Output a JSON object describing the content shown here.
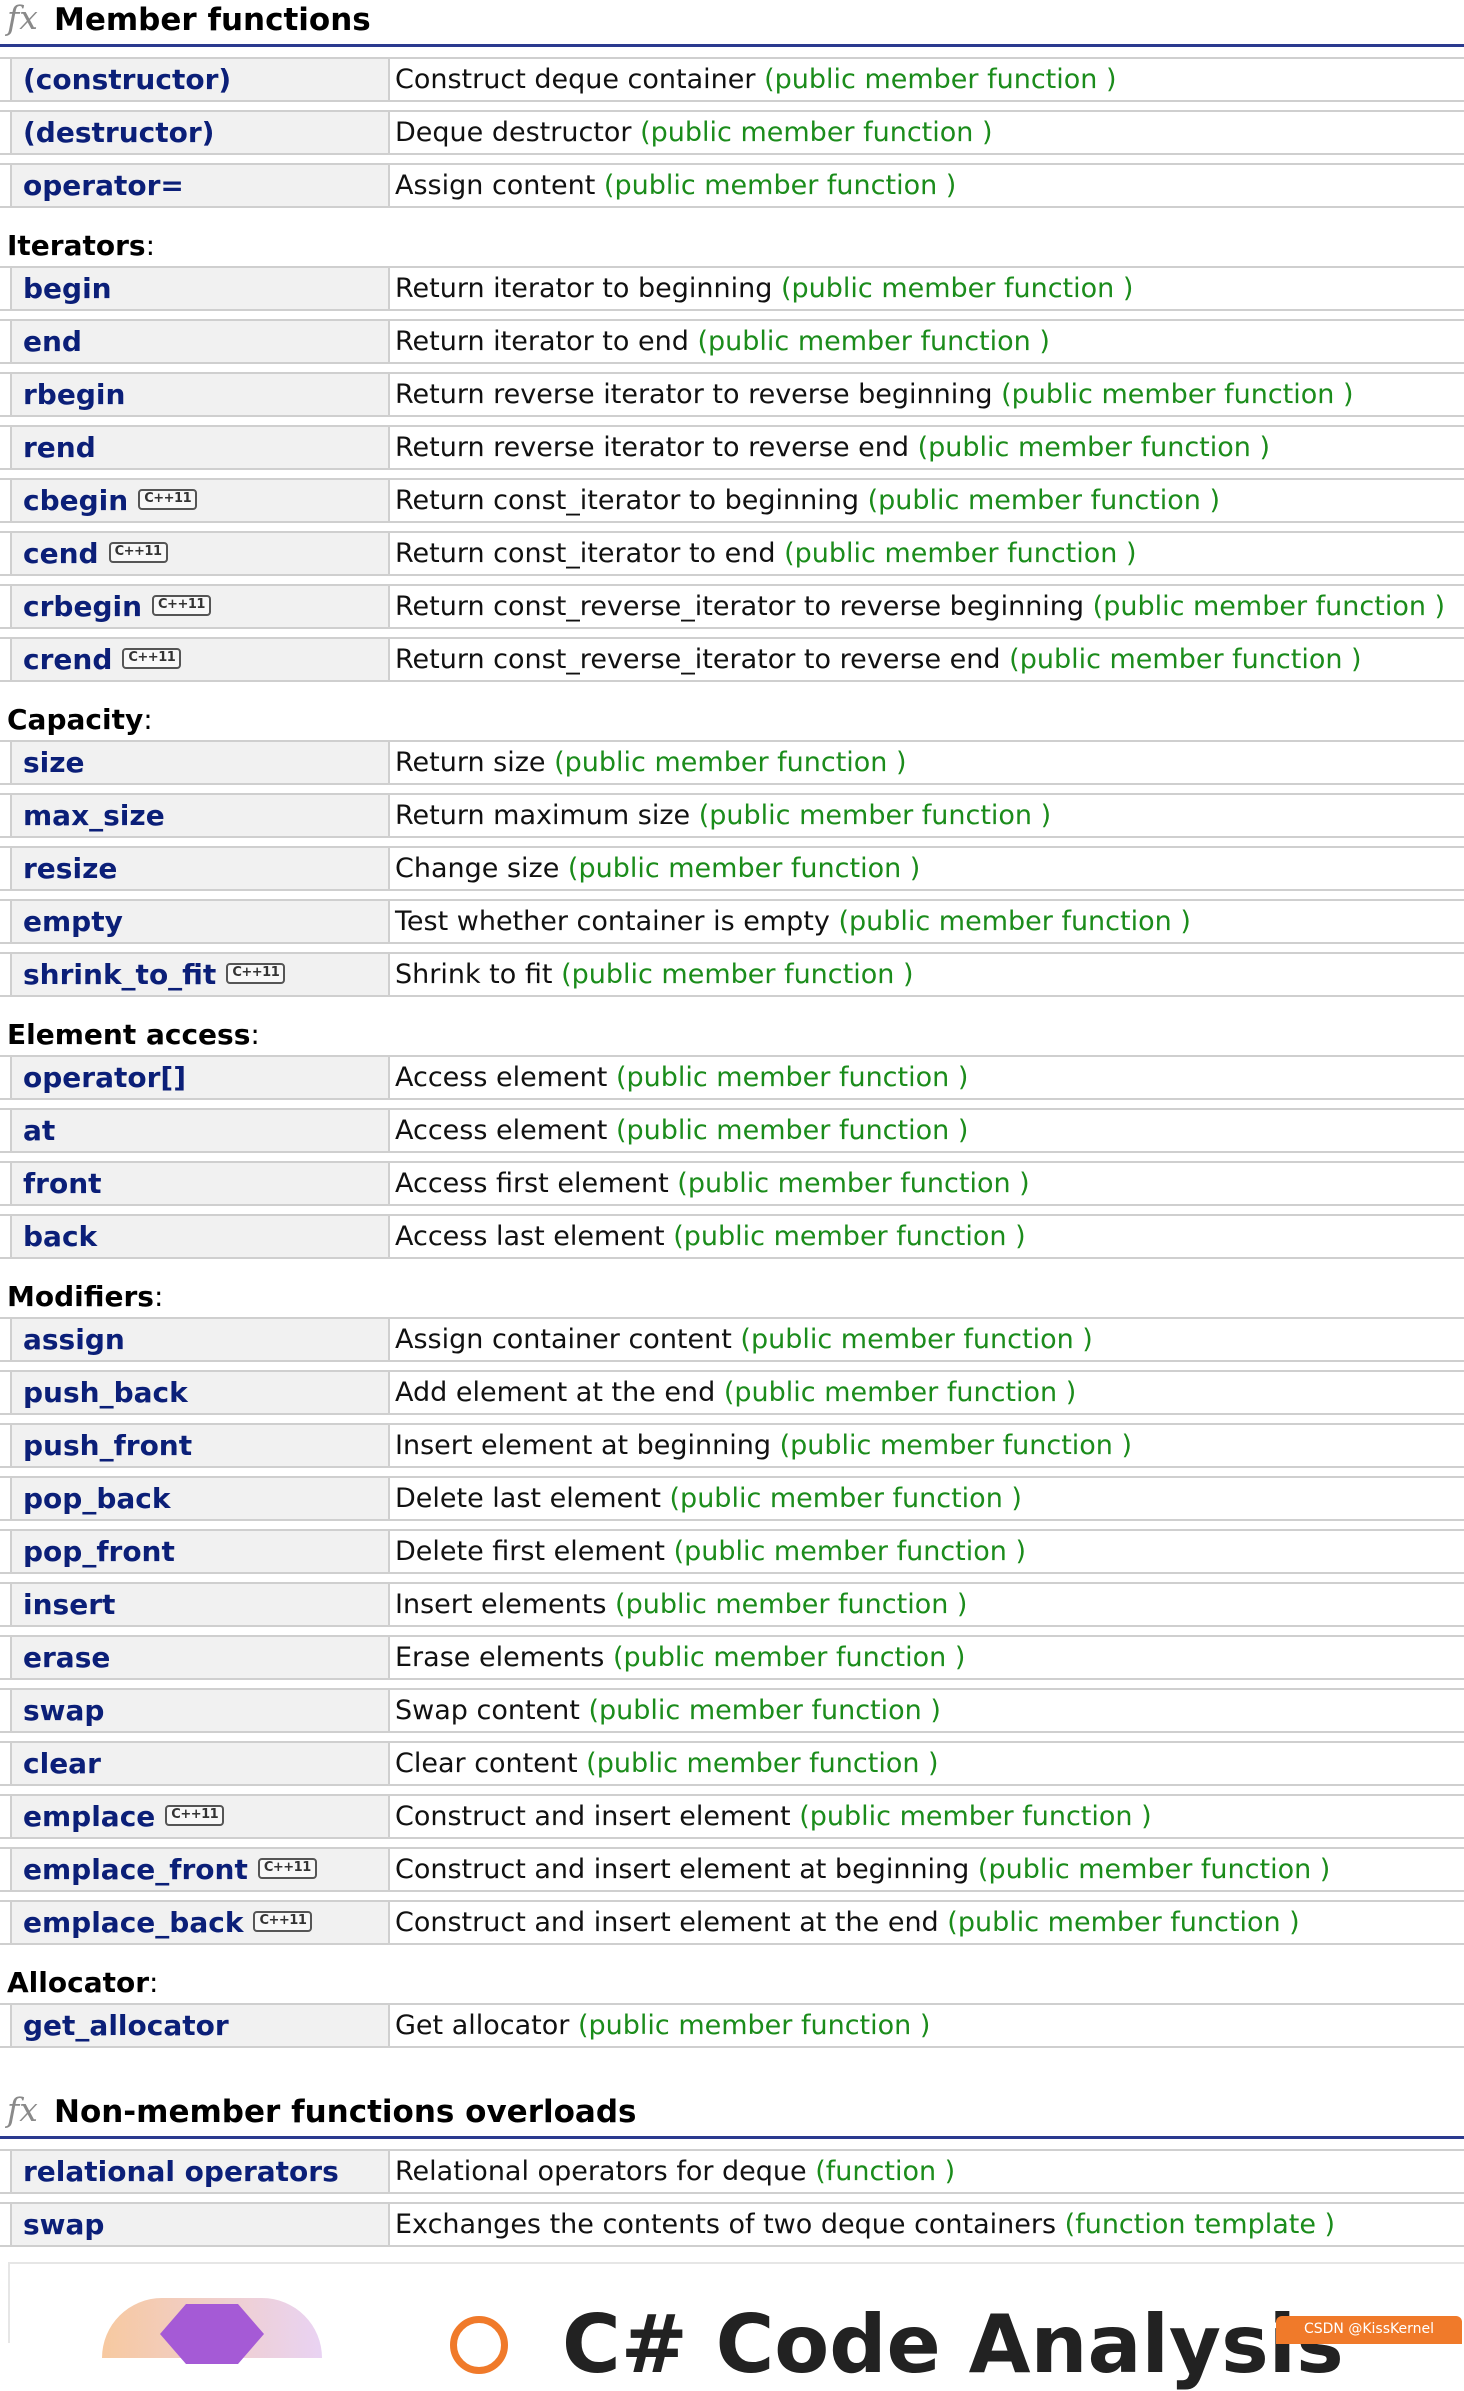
{
  "sections": [
    {
      "header": "Member functions",
      "groups": [
        {
          "label": "",
          "rows": [
            {
              "name": "(constructor)",
              "desc": "Construct deque container",
              "kind": "(public member function )",
              "cxx11": false
            },
            {
              "name": "(destructor)",
              "desc": "Deque destructor",
              "kind": "(public member function )",
              "cxx11": false
            },
            {
              "name": "operator=",
              "desc": "Assign content",
              "kind": "(public member function )",
              "cxx11": false
            }
          ]
        },
        {
          "label": "Iterators",
          "rows": [
            {
              "name": "begin",
              "desc": "Return iterator to beginning",
              "kind": "(public member function )",
              "cxx11": false
            },
            {
              "name": "end",
              "desc": "Return iterator to end",
              "kind": "(public member function )",
              "cxx11": false
            },
            {
              "name": "rbegin",
              "desc": "Return reverse iterator to reverse beginning",
              "kind": "(public member function )",
              "cxx11": false
            },
            {
              "name": "rend",
              "desc": "Return reverse iterator to reverse end",
              "kind": "(public member function )",
              "cxx11": false
            },
            {
              "name": "cbegin",
              "desc": "Return const_iterator to beginning",
              "kind": "(public member function )",
              "cxx11": true
            },
            {
              "name": "cend",
              "desc": "Return const_iterator to end",
              "kind": "(public member function )",
              "cxx11": true
            },
            {
              "name": "crbegin",
              "desc": "Return const_reverse_iterator to reverse beginning",
              "kind": "(public member function )",
              "cxx11": true
            },
            {
              "name": "crend",
              "desc": "Return const_reverse_iterator to reverse end",
              "kind": "(public member function )",
              "cxx11": true
            }
          ]
        },
        {
          "label": "Capacity",
          "rows": [
            {
              "name": "size",
              "desc": "Return size",
              "kind": "(public member function )",
              "cxx11": false
            },
            {
              "name": "max_size",
              "desc": "Return maximum size",
              "kind": "(public member function )",
              "cxx11": false
            },
            {
              "name": "resize",
              "desc": "Change size",
              "kind": "(public member function )",
              "cxx11": false
            },
            {
              "name": "empty",
              "desc": "Test whether container is empty",
              "kind": "(public member function )",
              "cxx11": false
            },
            {
              "name": "shrink_to_fit",
              "desc": "Shrink to fit",
              "kind": "(public member function )",
              "cxx11": true
            }
          ]
        },
        {
          "label": "Element access",
          "rows": [
            {
              "name": "operator[]",
              "desc": "Access element",
              "kind": "(public member function )",
              "cxx11": false
            },
            {
              "name": "at",
              "desc": "Access element",
              "kind": "(public member function )",
              "cxx11": false
            },
            {
              "name": "front",
              "desc": "Access first element",
              "kind": "(public member function )",
              "cxx11": false
            },
            {
              "name": "back",
              "desc": "Access last element",
              "kind": "(public member function )",
              "cxx11": false
            }
          ]
        },
        {
          "label": "Modifiers",
          "rows": [
            {
              "name": "assign",
              "desc": "Assign container content",
              "kind": "(public member function )",
              "cxx11": false
            },
            {
              "name": "push_back",
              "desc": "Add element at the end",
              "kind": "(public member function )",
              "cxx11": false
            },
            {
              "name": "push_front",
              "desc": "Insert element at beginning",
              "kind": "(public member function )",
              "cxx11": false
            },
            {
              "name": "pop_back",
              "desc": "Delete last element",
              "kind": "(public member function )",
              "cxx11": false
            },
            {
              "name": "pop_front",
              "desc": "Delete first element",
              "kind": "(public member function )",
              "cxx11": false
            },
            {
              "name": "insert",
              "desc": "Insert elements",
              "kind": "(public member function )",
              "cxx11": false
            },
            {
              "name": "erase",
              "desc": "Erase elements",
              "kind": "(public member function )",
              "cxx11": false
            },
            {
              "name": "swap",
              "desc": "Swap content",
              "kind": "(public member function )",
              "cxx11": false
            },
            {
              "name": "clear",
              "desc": "Clear content",
              "kind": "(public member function )",
              "cxx11": false
            },
            {
              "name": "emplace",
              "desc": "Construct and insert element",
              "kind": "(public member function )",
              "cxx11": true
            },
            {
              "name": "emplace_front",
              "desc": "Construct and insert element at beginning",
              "kind": "(public member function )",
              "cxx11": true
            },
            {
              "name": "emplace_back",
              "desc": "Construct and insert element at the end",
              "kind": "(public member function )",
              "cxx11": true
            }
          ]
        },
        {
          "label": "Allocator",
          "rows": [
            {
              "name": "get_allocator",
              "desc": "Get allocator",
              "kind": "(public member function )",
              "cxx11": false
            }
          ]
        }
      ]
    },
    {
      "header": "Non-member functions overloads",
      "groups": [
        {
          "label": "",
          "rows": [
            {
              "name": "relational operators",
              "desc": "Relational operators for deque",
              "kind": "(function )",
              "cxx11": false
            },
            {
              "name": "swap",
              "desc": "Exchanges the contents of two deque containers",
              "kind": "(function template )",
              "cxx11": false
            }
          ]
        }
      ]
    }
  ],
  "fx_symbol": "fx",
  "cxx11_badge": "C++11",
  "group_colon": ":",
  "banner": {
    "title": "C# Code Analysis",
    "watermark": "CSDN @KissKernel"
  },
  "colors": {
    "function_name": "#0b1f78",
    "kind_text": "#1b8c1b",
    "header_rule": "#2a3a8f"
  }
}
